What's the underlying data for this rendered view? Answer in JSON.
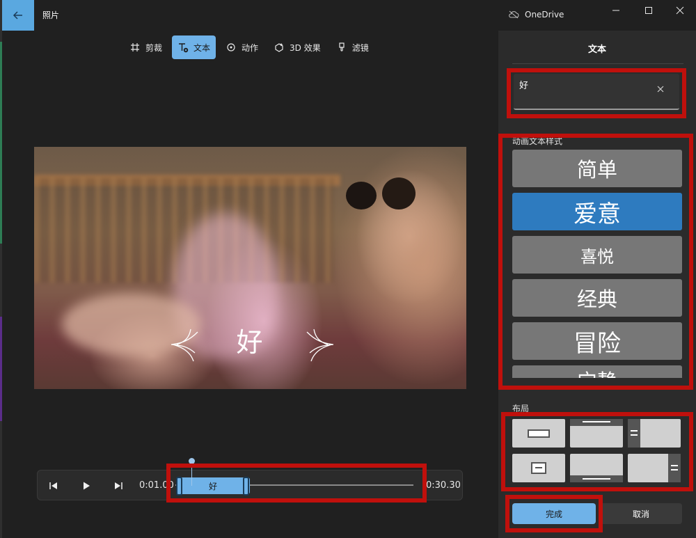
{
  "window": {
    "title": "照片",
    "onedrive_label": "OneDrive"
  },
  "toolbar": {
    "crop": "剪裁",
    "text": "文本",
    "motion": "动作",
    "effects_3d": "3D 效果",
    "filters": "滤镜"
  },
  "video": {
    "caption": "好"
  },
  "player": {
    "start_time": "0:01.00",
    "end_time": "0:30.30",
    "clip_label": "好"
  },
  "panel": {
    "title": "文本",
    "text_value": "好",
    "styles_label": "动画文本样式",
    "styles": [
      {
        "label": "简单",
        "selected": false
      },
      {
        "label": "爱意",
        "selected": true
      },
      {
        "label": "喜悦",
        "selected": false
      },
      {
        "label": "经典",
        "selected": false
      },
      {
        "label": "冒险",
        "selected": false
      },
      {
        "label": "宁静",
        "selected": false
      }
    ],
    "layout_label": "布局",
    "done_button": "完成",
    "cancel_button": "取消"
  },
  "colors": {
    "accent": "#6fb2e8",
    "selected_style": "#2e7bbf",
    "highlight": "#c0100c"
  }
}
